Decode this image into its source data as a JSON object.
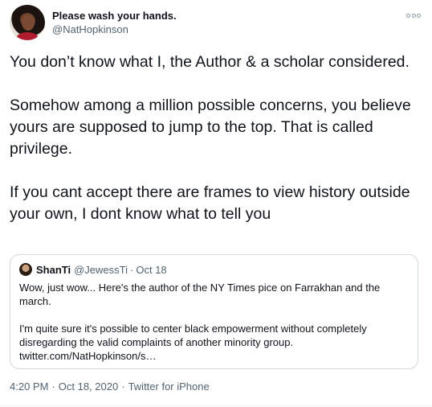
{
  "author": {
    "name": "Please wash your hands.",
    "handle": "@NatHopkinson"
  },
  "tweet": {
    "paragraphs": [
      "You don’t know what I, the Author & a scholar considered.",
      "Somehow among a million possible concerns, you believe yours are supposed to jump to the top. That is called privilege.",
      "If you cant accept there are frames to view history outside your own, I dont know what to tell you"
    ]
  },
  "quoted_tweet": {
    "name": "ShanTi",
    "handle": "@JewessTi",
    "separator": "·",
    "date": "Oct 18",
    "paragraphs": [
      "Wow, just wow... Here's the author of the NY Times pice on Farrakhan and the march.",
      "I'm quite sure it's possible to center black empowerment without completely disregarding the valid complaints of another minority group. twitter.com/NatHopkinson/s…"
    ]
  },
  "meta": {
    "time": "4:20 PM",
    "date": "Oct 18, 2020",
    "separator": "·",
    "source": "Twitter for iPhone"
  },
  "icons": {
    "more": "more-options-icon"
  },
  "colors": {
    "text": "#0f1419",
    "secondary": "#536471",
    "border": "#cfd9de"
  }
}
